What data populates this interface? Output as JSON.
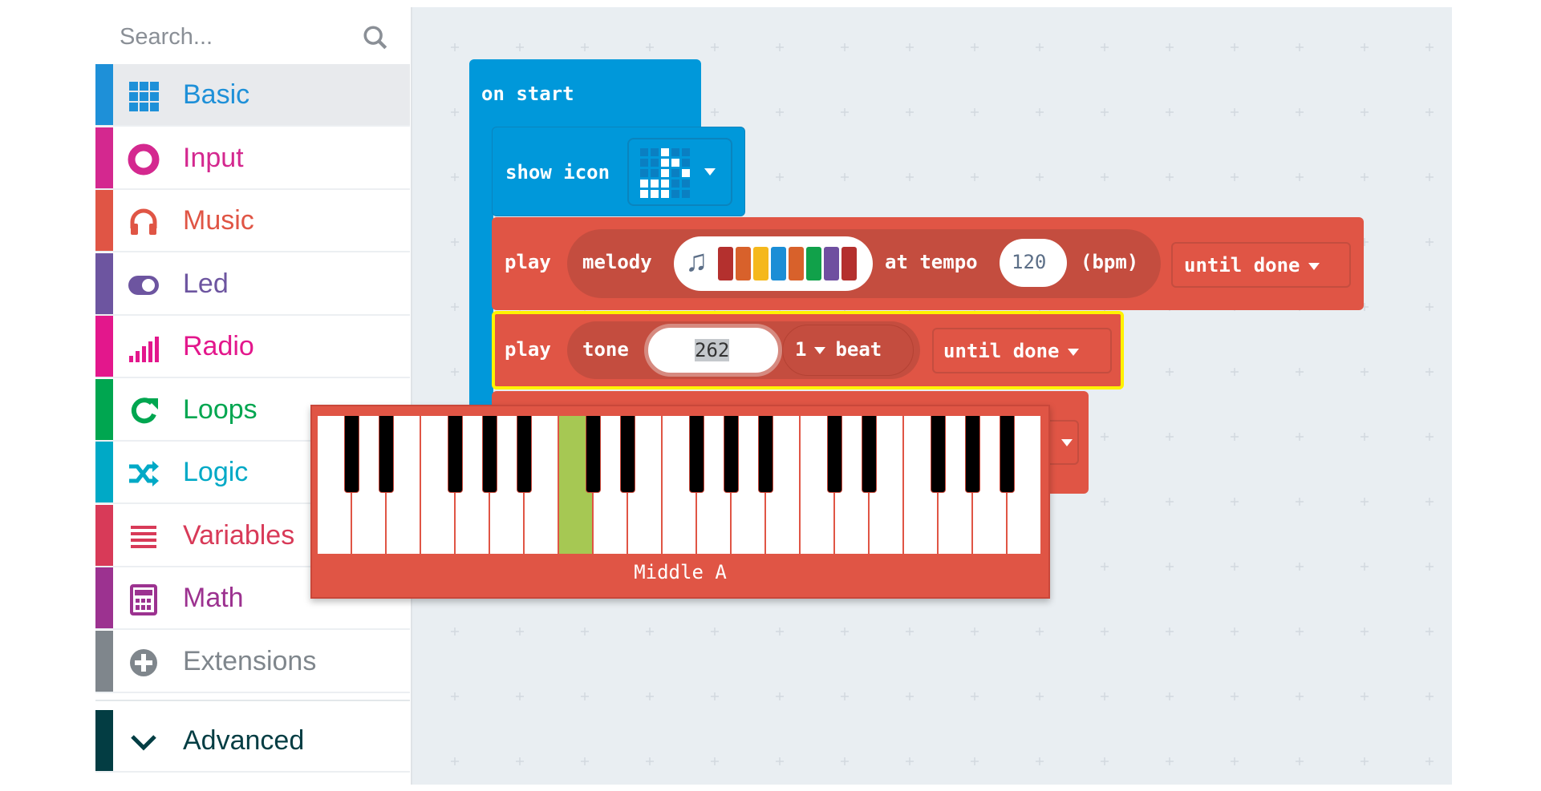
{
  "search": {
    "placeholder": "Search...",
    "icon": "search-icon"
  },
  "categories": [
    {
      "label": "Basic",
      "color": "#1e90d8",
      "icon": "grid-icon",
      "selected": true
    },
    {
      "label": "Input",
      "color": "#d4288f",
      "icon": "input-circle-icon"
    },
    {
      "label": "Music",
      "color": "#e05545",
      "icon": "headphones-icon"
    },
    {
      "label": "Led",
      "color": "#6d55a0",
      "icon": "toggle-icon"
    },
    {
      "label": "Radio",
      "color": "#e3178c",
      "icon": "signal-bars-icon"
    },
    {
      "label": "Loops",
      "color": "#00a650",
      "icon": "refresh-icon"
    },
    {
      "label": "Logic",
      "color": "#00a9c6",
      "icon": "shuffle-icon"
    },
    {
      "label": "Variables",
      "color": "#d83a58",
      "icon": "list-icon"
    },
    {
      "label": "Math",
      "color": "#9c3290",
      "icon": "calculator-icon"
    },
    {
      "label": "Extensions",
      "color": "#7f868c",
      "icon": "plus-circle-icon"
    }
  ],
  "advanced": {
    "label": "Advanced",
    "color": "#033d43",
    "icon": "chevron-down-icon"
  },
  "blocks": {
    "on_start": {
      "label": "on start",
      "color": "#0098da"
    },
    "show_icon": {
      "label": "show icon",
      "leds": [
        [
          0,
          0,
          1,
          0,
          0
        ],
        [
          0,
          0,
          1,
          1,
          0
        ],
        [
          0,
          0,
          1,
          0,
          1
        ],
        [
          1,
          1,
          1,
          0,
          0
        ],
        [
          1,
          1,
          1,
          0,
          0
        ]
      ]
    },
    "play_melody": {
      "play": "play",
      "melody": "melody",
      "melody_colors": [
        "#b4302e",
        "#d8612b",
        "#f5b81c",
        "#1b8ed6",
        "#d8612b",
        "#11a14a",
        "#6f4fa0",
        "#b4302e"
      ],
      "at_tempo": "at tempo",
      "tempo": "120",
      "bpm": "(bpm)",
      "mode": "until done",
      "color": "#e05545"
    },
    "play_tone": {
      "play": "play",
      "tone": "tone",
      "value": "262",
      "beats": "1",
      "beat": "beat",
      "mode": "until done"
    }
  },
  "piano": {
    "label": "Middle A",
    "white_keys": 21,
    "selected_white_key": 7,
    "highlight": "#a6c853"
  }
}
